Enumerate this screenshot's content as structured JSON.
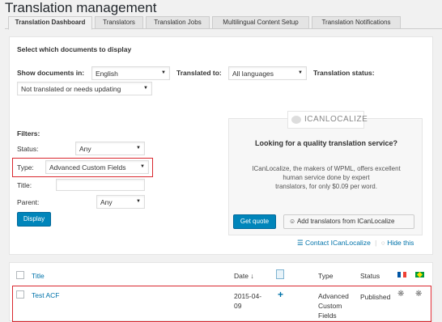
{
  "page": {
    "title": "Translation management"
  },
  "tabs": [
    {
      "label": "Translation Dashboard",
      "active": true
    },
    {
      "label": "Translators"
    },
    {
      "label": "Translation Jobs"
    },
    {
      "label": "Multilingual Content Setup"
    },
    {
      "label": "Translation Notifications"
    }
  ],
  "filter_panel": {
    "heading": "Select which documents to display",
    "show_documents_label": "Show documents in:",
    "show_documents_value": "English",
    "translated_to_label": "Translated to:",
    "translated_to_value": "All languages",
    "translation_status_label": "Translation status:",
    "translation_status_value": "Not translated or needs updating",
    "filters_heading": "Filters:",
    "status_label": "Status:",
    "status_value": "Any",
    "type_label": "Type:",
    "type_value": "Advanced Custom Fields",
    "title_label": "Title:",
    "title_value": "",
    "parent_label": "Parent:",
    "parent_value": "Any",
    "display_button": "Display"
  },
  "promo": {
    "logo_text": "ICANLOCALIZE",
    "heading": "Looking for a quality translation service?",
    "body_line1": "ICanLocalize, the makers of WPML, offers excellent",
    "body_line2": "human service done by expert",
    "body_line3": "translators, for only $0.09 per word.",
    "get_quote_button": "Get quote",
    "add_translators_button": "Add translators from ICanLocalize",
    "contact_link": "Contact ICanLocalize",
    "hide_link": "Hide this"
  },
  "table": {
    "columns": {
      "title": "Title",
      "date": "Date ↓",
      "type": "Type",
      "status": "Status"
    },
    "rows": [
      {
        "title": "Test ACF",
        "date_line1": "2015-04-",
        "date_line2": "09",
        "action_icon": "+",
        "type_line1": "Advanced",
        "type_line2": "Custom",
        "type_line3": "Fields",
        "status": "Published"
      }
    ]
  },
  "colors": {
    "accent": "#0073aa",
    "button": "#0085ba",
    "highlight": "#d9272e"
  }
}
